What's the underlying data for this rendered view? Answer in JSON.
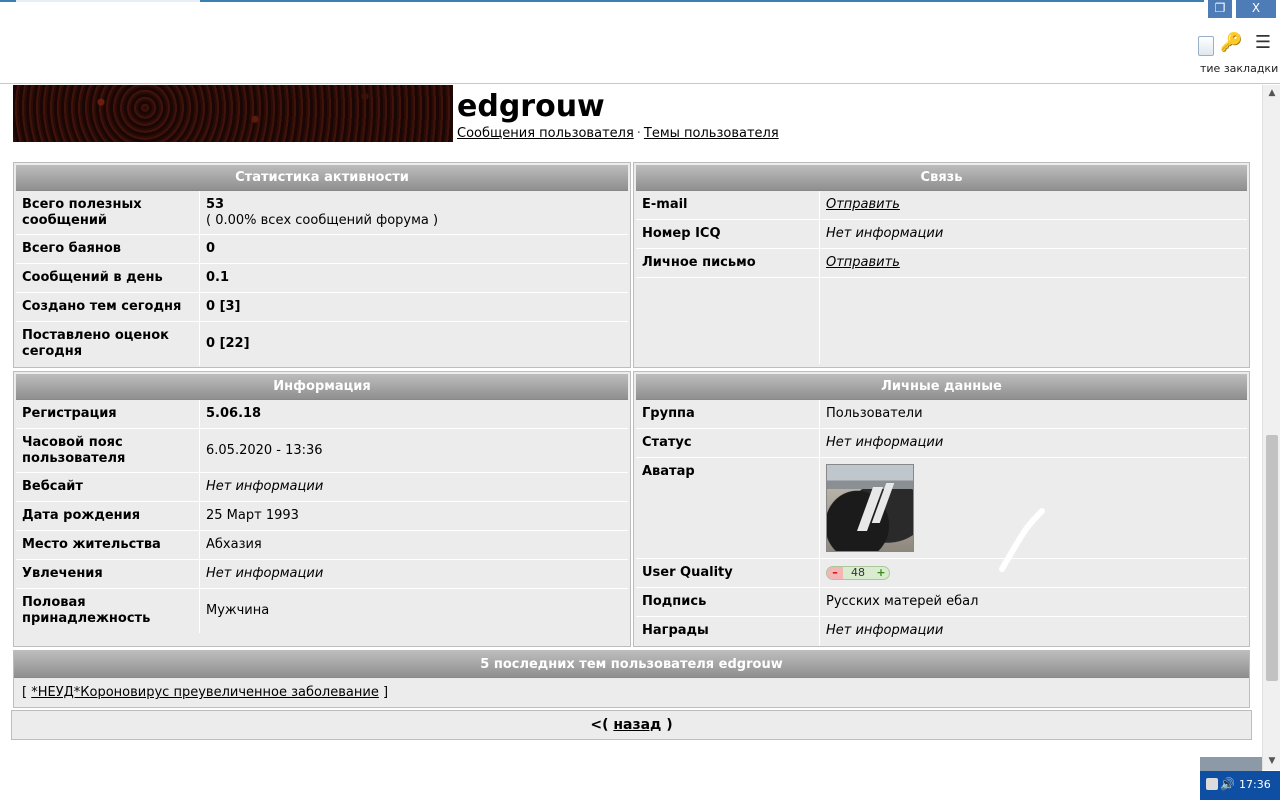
{
  "browser": {
    "restore_glyph": "❐",
    "close_glyph": "X",
    "bookmarks_label": "тие закладки",
    "key_icon": "key-icon",
    "menu_icon": "menu-icon"
  },
  "profile": {
    "username": "edgrouw",
    "links": {
      "messages": "Сообщения пользователя",
      "separator": "·",
      "topics": "Темы пользователя"
    }
  },
  "activity": {
    "title": "Статистика активности",
    "rows": [
      {
        "label": "Всего полезных сообщений",
        "value": "53",
        "sub": "( 0.00% всех сообщений форума )"
      },
      {
        "label": "Всего баянов",
        "value": "0"
      },
      {
        "label": "Сообщений в день",
        "value": "0.1"
      },
      {
        "label": "Создано тем сегодня",
        "value": "0 [3]"
      },
      {
        "label": "Поставлено оценок сегодня",
        "value": "0 [22]"
      }
    ]
  },
  "contact": {
    "title": "Связь",
    "rows": [
      {
        "label": "E-mail",
        "value": "Отправить"
      },
      {
        "label": "Номер ICQ",
        "value": "Нет информации"
      },
      {
        "label": "Личное письмо",
        "value": "Отправить"
      }
    ]
  },
  "info": {
    "title": "Информация",
    "rows": [
      {
        "label": "Регистрация",
        "value": "5.06.18"
      },
      {
        "label": "Часовой пояс пользователя",
        "value": "6.05.2020 - 13:36"
      },
      {
        "label": "Вебсайт",
        "value": "Нет информации"
      },
      {
        "label": "Дата рождения",
        "value": "25 Март 1993"
      },
      {
        "label": "Место жительства",
        "value": "Абхазия"
      },
      {
        "label": "Увлечения",
        "value": "Нет информации"
      },
      {
        "label": "Половая принадлежность",
        "value": "Мужчина"
      }
    ]
  },
  "personal": {
    "title": "Личные данные",
    "rows": [
      {
        "label": "Группа",
        "value": "Пользователи"
      },
      {
        "label": "Статус",
        "value": "Нет информации"
      },
      {
        "label": "Аватар"
      },
      {
        "label": "User Quality",
        "minus": "–",
        "value": "48",
        "plus": "+"
      },
      {
        "label": "Подпись",
        "value": "Русских матерей ебал"
      },
      {
        "label": "Награды",
        "value": "Нет информации"
      }
    ]
  },
  "recent": {
    "title": "5 последних тем пользователя edgrouw",
    "open": "[",
    "topic": "*НЕУД*Короновирус преувеличенное заболевание",
    "close": "]"
  },
  "back": {
    "prefix": "<(",
    "label": "назад",
    "suffix": ")"
  },
  "taskbar": {
    "time": "17:36"
  }
}
